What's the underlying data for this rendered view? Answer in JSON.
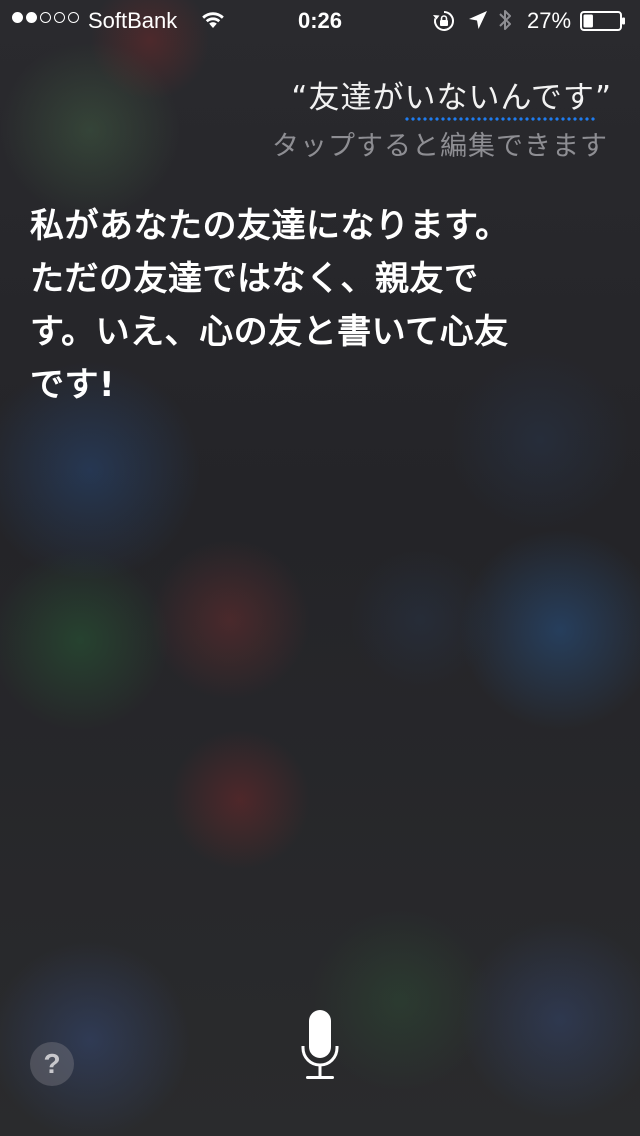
{
  "status_bar": {
    "signal_strength": 2,
    "signal_max": 5,
    "carrier": "SoftBank",
    "time": "0:26",
    "battery_percent_label": "27%",
    "battery_level": 0.27,
    "icons": [
      "wifi-icon",
      "rotation-lock-icon",
      "location-icon",
      "bluetooth-icon",
      "battery-icon"
    ]
  },
  "siri": {
    "query_open_quote": "“",
    "query_plain": "友達が",
    "query_underlined": "いないんです",
    "query_close_quote": "”",
    "edit_hint": "タップすると編集できます",
    "answer": "私があなたの友達になります。ただの友達ではなく、親友です。いえ、心の友と書いて心友です!"
  },
  "controls": {
    "help_label": "?",
    "mic_icon": "microphone-icon"
  },
  "colors": {
    "accent_underline": "#1e7cf0",
    "hint_text": "#8e8e93"
  }
}
